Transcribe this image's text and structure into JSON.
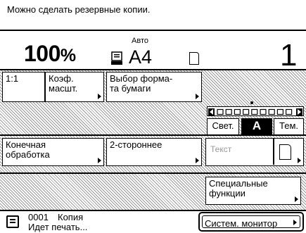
{
  "message": "Можно сделать резервные копии.",
  "status": {
    "ratio": "100",
    "ratio_unit": "%",
    "paper_mode": "Авто",
    "paper_size": "A4",
    "copies": "1"
  },
  "buttons": {
    "one_to_one": "1:1",
    "zoom": [
      "Коэф.",
      "масшт."
    ],
    "paper_select": [
      "Выбор форма-",
      "та бумаги"
    ],
    "finishing": [
      "Конечная",
      "обработка"
    ],
    "duplex": "2-стороннее",
    "special": [
      "Специальные",
      "функции"
    ]
  },
  "density": {
    "light": "Свет.",
    "auto": "A",
    "dark": "Тем.",
    "level": 5,
    "steps": 9
  },
  "original_type": "Текст",
  "job": {
    "number": "0001",
    "kind": "Копия",
    "status": "Идет печать..."
  },
  "monitor_button": "Систем. монитор"
}
